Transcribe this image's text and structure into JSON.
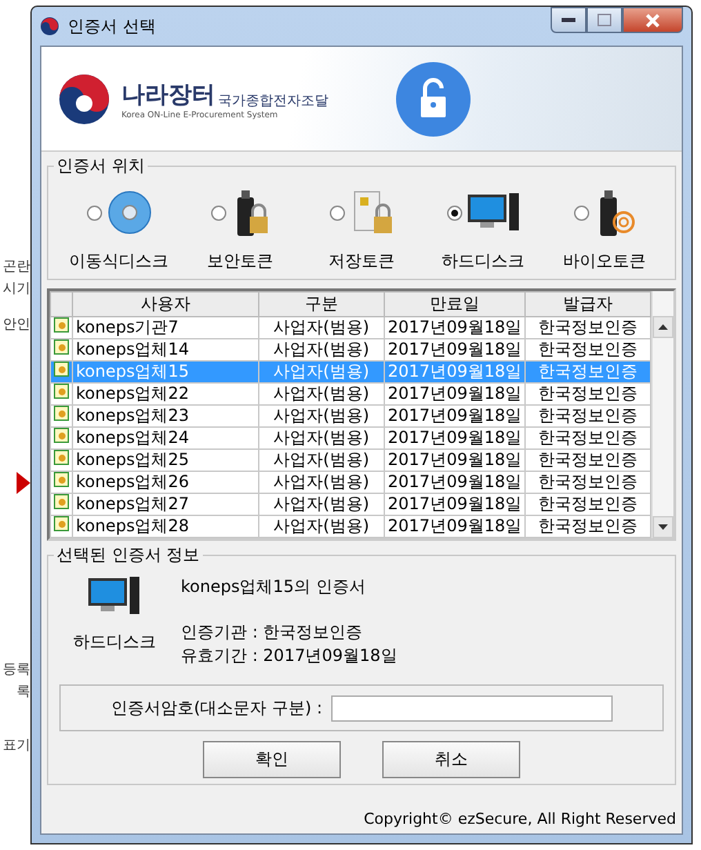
{
  "background": {
    "fragments": [
      "곤란",
      "시기",
      "안인",
      "등록",
      "록",
      "표기"
    ]
  },
  "window": {
    "title": "인증서 선택"
  },
  "banner": {
    "logo_name": "나라장터",
    "logo_sub": "국가종합전자조달",
    "logo_en": "Korea ON-Line E-Procurement System"
  },
  "location": {
    "title": "인증서 위치",
    "options": [
      {
        "kind": "disc",
        "label": "이동식디스크",
        "selected": false
      },
      {
        "kind": "token",
        "label": "보안토큰",
        "selected": false
      },
      {
        "kind": "card",
        "label": "저장토큰",
        "selected": false
      },
      {
        "kind": "computer",
        "label": "하드디스크",
        "selected": true
      },
      {
        "kind": "bio",
        "label": "바이오토큰",
        "selected": false
      }
    ]
  },
  "table": {
    "columns": [
      "사용자",
      "구분",
      "만료일",
      "발급자"
    ],
    "rows": [
      {
        "cells": [
          "koneps기관7",
          "사업자(범용)",
          "2017년09월18일",
          "한국정보인증"
        ],
        "selected": false
      },
      {
        "cells": [
          "koneps업체14",
          "사업자(범용)",
          "2017년09월18일",
          "한국정보인증"
        ],
        "selected": false
      },
      {
        "cells": [
          "koneps업체15",
          "사업자(범용)",
          "2017년09월18일",
          "한국정보인증"
        ],
        "selected": true
      },
      {
        "cells": [
          "koneps업체22",
          "사업자(범용)",
          "2017년09월18일",
          "한국정보인증"
        ],
        "selected": false
      },
      {
        "cells": [
          "koneps업체23",
          "사업자(범용)",
          "2017년09월18일",
          "한국정보인증"
        ],
        "selected": false
      },
      {
        "cells": [
          "koneps업체24",
          "사업자(범용)",
          "2017년09월18일",
          "한국정보인증"
        ],
        "selected": false
      },
      {
        "cells": [
          "koneps업체25",
          "사업자(범용)",
          "2017년09월18일",
          "한국정보인증"
        ],
        "selected": false
      },
      {
        "cells": [
          "koneps업체26",
          "사업자(범용)",
          "2017년09월18일",
          "한국정보인증"
        ],
        "selected": false
      },
      {
        "cells": [
          "koneps업체27",
          "사업자(범용)",
          "2017년09월18일",
          "한국정보인증"
        ],
        "selected": false
      },
      {
        "cells": [
          "koneps업체28",
          "사업자(범용)",
          "2017년09월18일",
          "한국정보인증"
        ],
        "selected": false
      }
    ]
  },
  "info": {
    "title": "선택된 인증서 정보",
    "device": "하드디스크",
    "name": "koneps업체15의 인증서",
    "issuer": "인증기관 : 한국정보인증",
    "validity": "유효기간 : 2017년09월18일"
  },
  "password": {
    "label": "인증서암호(대소문자 구분) :"
  },
  "buttons": [
    "확인",
    "취소"
  ],
  "copyright": "Copyright© ezSecure, All Right Reserved"
}
